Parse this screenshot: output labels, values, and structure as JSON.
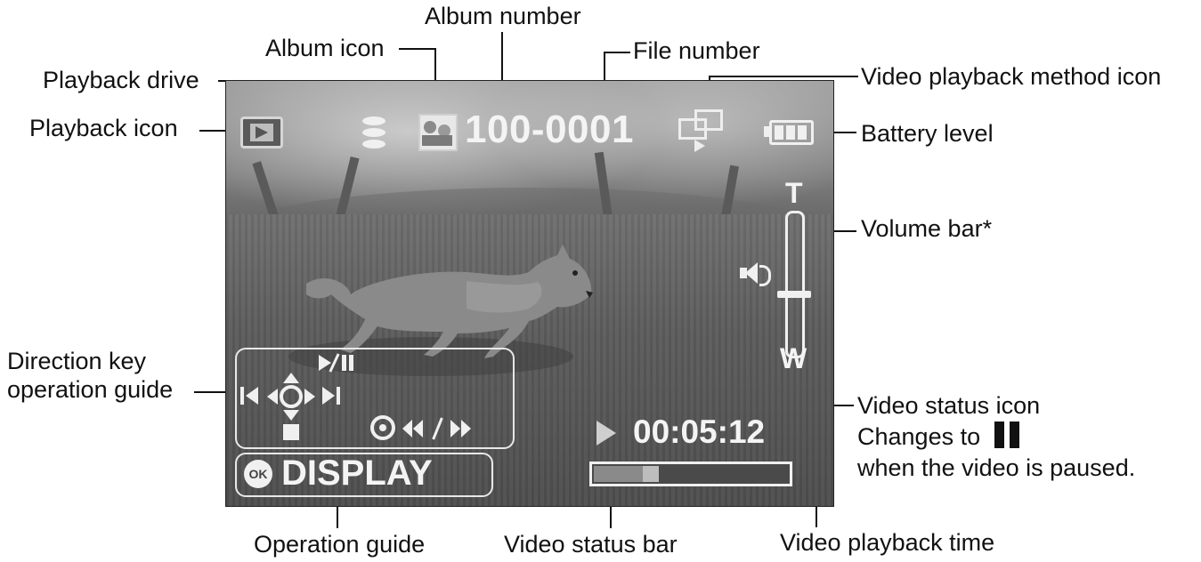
{
  "callouts": {
    "album_number": "Album number",
    "album_icon": "Album icon",
    "file_number": "File number",
    "playback_drive": "Playback drive",
    "video_playback_method_icon": "Video playback method icon",
    "playback_icon": "Playback icon",
    "battery_level": "Battery level",
    "volume_bar": "Volume bar*",
    "direction_key_guide": "Direction key operation guide",
    "video_status_icon_title": "Video status icon",
    "video_status_icon_note_before": "Changes to",
    "video_status_icon_note_after": "when the video is paused.",
    "operation_guide": "Operation guide",
    "video_status_bar": "Video status bar",
    "video_playback_time": "Video playback time"
  },
  "screen": {
    "album_file_number": "100-0001",
    "playback_time": "00:05:12",
    "display_label": "DISPLAY",
    "ok_label": "OK",
    "zoom_top": "T",
    "zoom_bottom": "W",
    "status_bar_progress": 0.26,
    "volume_level": 0.41
  },
  "icons": {
    "playback": "playback-icon",
    "drive": "playback-drive-icon",
    "album": "album-icon",
    "method": "video-playback-method-icon",
    "battery": "battery-icon",
    "speaker": "speaker-icon",
    "status": "video-status-play-icon",
    "pause": "pause-icon"
  },
  "colors": {
    "screen_text": "#f4f4f4",
    "label_text": "#111111"
  }
}
